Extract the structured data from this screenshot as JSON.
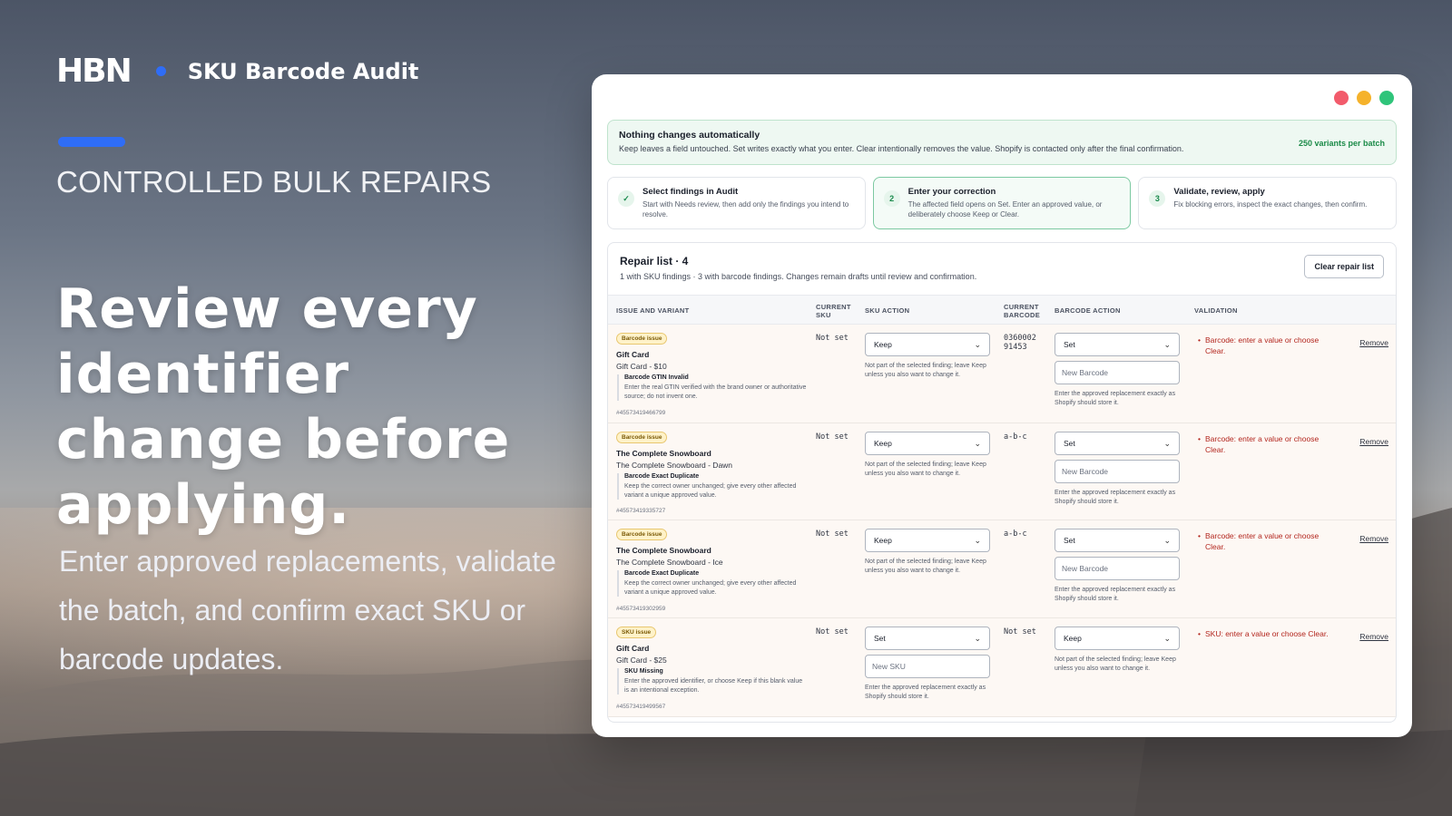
{
  "brand": {
    "logo": "HBN",
    "title": "SKU Barcode Audit"
  },
  "hero": {
    "kicker": "CONTROLLED BULK REPAIRS",
    "headline": "Review every identifier change before applying.",
    "subtext": "Enter approved replacements, validate the batch, and confirm exact SKU or barcode updates."
  },
  "colors": {
    "accent": "#2f6df6",
    "success": "#1b8a48",
    "error": "#b3261e",
    "issue_tag": "#fff2c9"
  },
  "banner": {
    "title": "Nothing changes automatically",
    "text": "Keep leaves a field untouched. Set writes exactly what you enter. Clear intentionally removes the value. Shopify is contacted only after the final confirmation.",
    "badge": "250 variants per batch"
  },
  "steps": [
    {
      "num": "✓",
      "title": "Select findings in Audit",
      "text": "Start with Needs review, then add only the findings you intend to resolve."
    },
    {
      "num": "2",
      "title": "Enter your correction",
      "text": "The affected field opens on Set. Enter an approved value, or deliberately choose Keep or Clear."
    },
    {
      "num": "3",
      "title": "Validate, review, apply",
      "text": "Fix blocking errors, inspect the exact changes, then confirm."
    }
  ],
  "repair": {
    "title": "Repair list · 4",
    "subtitle": "1 with SKU findings · 3 with barcode findings. Changes remain drafts until review and confirmation.",
    "clear_button": "Clear repair list",
    "columns": [
      "ISSUE AND VARIANT",
      "CURRENT SKU",
      "SKU ACTION",
      "CURRENT BARCODE",
      "BARCODE ACTION",
      "VALIDATION"
    ],
    "rows": [
      {
        "tag": "Barcode issue",
        "product": "Gift Card",
        "variant": "Gift Card - $10",
        "finding_title": "Barcode GTIN Invalid",
        "finding_text": "Enter the real GTIN verified with the brand owner or authoritative source; do not invent one.",
        "id": "#45573419466799",
        "current_sku": "Not set",
        "sku_action": "Keep",
        "sku_hint": "Not part of the selected finding; leave Keep unless you also want to change it.",
        "current_barcode": "0360002 91453",
        "barcode_action": "Set",
        "barcode_placeholder": "New Barcode",
        "barcode_hint": "Enter the approved replacement exactly as Shopify should store it.",
        "validation": "Barcode: enter a value or choose Clear.",
        "remove": "Remove"
      },
      {
        "tag": "Barcode issue",
        "product": "The Complete Snowboard",
        "variant": "The Complete Snowboard - Dawn",
        "finding_title": "Barcode Exact Duplicate",
        "finding_text": "Keep the correct owner unchanged; give every other affected variant a unique approved value.",
        "id": "#45573419335727",
        "current_sku": "Not set",
        "sku_action": "Keep",
        "sku_hint": "Not part of the selected finding; leave Keep unless you also want to change it.",
        "current_barcode": "a-b-c",
        "barcode_action": "Set",
        "barcode_placeholder": "New Barcode",
        "barcode_hint": "Enter the approved replacement exactly as Shopify should store it.",
        "validation": "Barcode: enter a value or choose Clear.",
        "remove": "Remove"
      },
      {
        "tag": "Barcode issue",
        "product": "The Complete Snowboard",
        "variant": "The Complete Snowboard - Ice",
        "finding_title": "Barcode Exact Duplicate",
        "finding_text": "Keep the correct owner unchanged; give every other affected variant a unique approved value.",
        "id": "#45573419302959",
        "current_sku": "Not set",
        "sku_action": "Keep",
        "sku_hint": "Not part of the selected finding; leave Keep unless you also want to change it.",
        "current_barcode": "a-b-c",
        "barcode_action": "Set",
        "barcode_placeholder": "New Barcode",
        "barcode_hint": "Enter the approved replacement exactly as Shopify should store it.",
        "validation": "Barcode: enter a value or choose Clear.",
        "remove": "Remove"
      },
      {
        "tag": "SKU issue",
        "product": "Gift Card",
        "variant": "Gift Card - $25",
        "finding_title": "SKU Missing",
        "finding_text": "Enter the approved identifier, or choose Keep if this blank value is an intentional exception.",
        "id": "#45573419499567",
        "current_sku": "Not set",
        "sku_action": "Set",
        "sku_placeholder": "New SKU",
        "sku_hint": "Enter the approved replacement exactly as Shopify should store it.",
        "current_barcode": "Not set",
        "barcode_action": "Keep",
        "barcode_hint": "Not part of the selected finding; leave Keep unless you also want to change it.",
        "validation": "SKU: enter a value or choose Clear.",
        "remove": "Remove"
      }
    ]
  }
}
